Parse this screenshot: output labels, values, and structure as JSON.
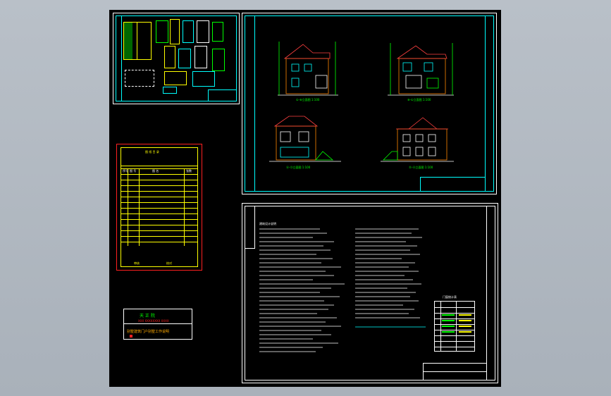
{
  "stamp": {
    "title": "天 正 院",
    "subtitle": "XXX XXXXXXXX XXXX",
    "project": "别墅建筑门户别墅工作说明"
  },
  "elevations": {
    "view1": "①-⑧立面图 1:100",
    "view2": "⑧-①立面图 1:100",
    "view3": "Ⓐ-Ⓓ立面图 1:100",
    "view4": "Ⓓ-Ⓐ立面图 1:100"
  },
  "catalog": {
    "header": "图 纸 目 录",
    "columns": [
      "序号",
      "图 号",
      "图 名",
      "张数"
    ],
    "footer_left": "审核",
    "footer_right": "校对"
  },
  "notes": {
    "heading": "建筑设计说明",
    "table_title": "门窗统计表"
  },
  "colors": {
    "background": "#000000",
    "frame": "#ffffff",
    "accent_yellow": "#ffff00",
    "accent_cyan": "#00ffff",
    "accent_green": "#00ff00",
    "accent_red": "#ff2020"
  }
}
